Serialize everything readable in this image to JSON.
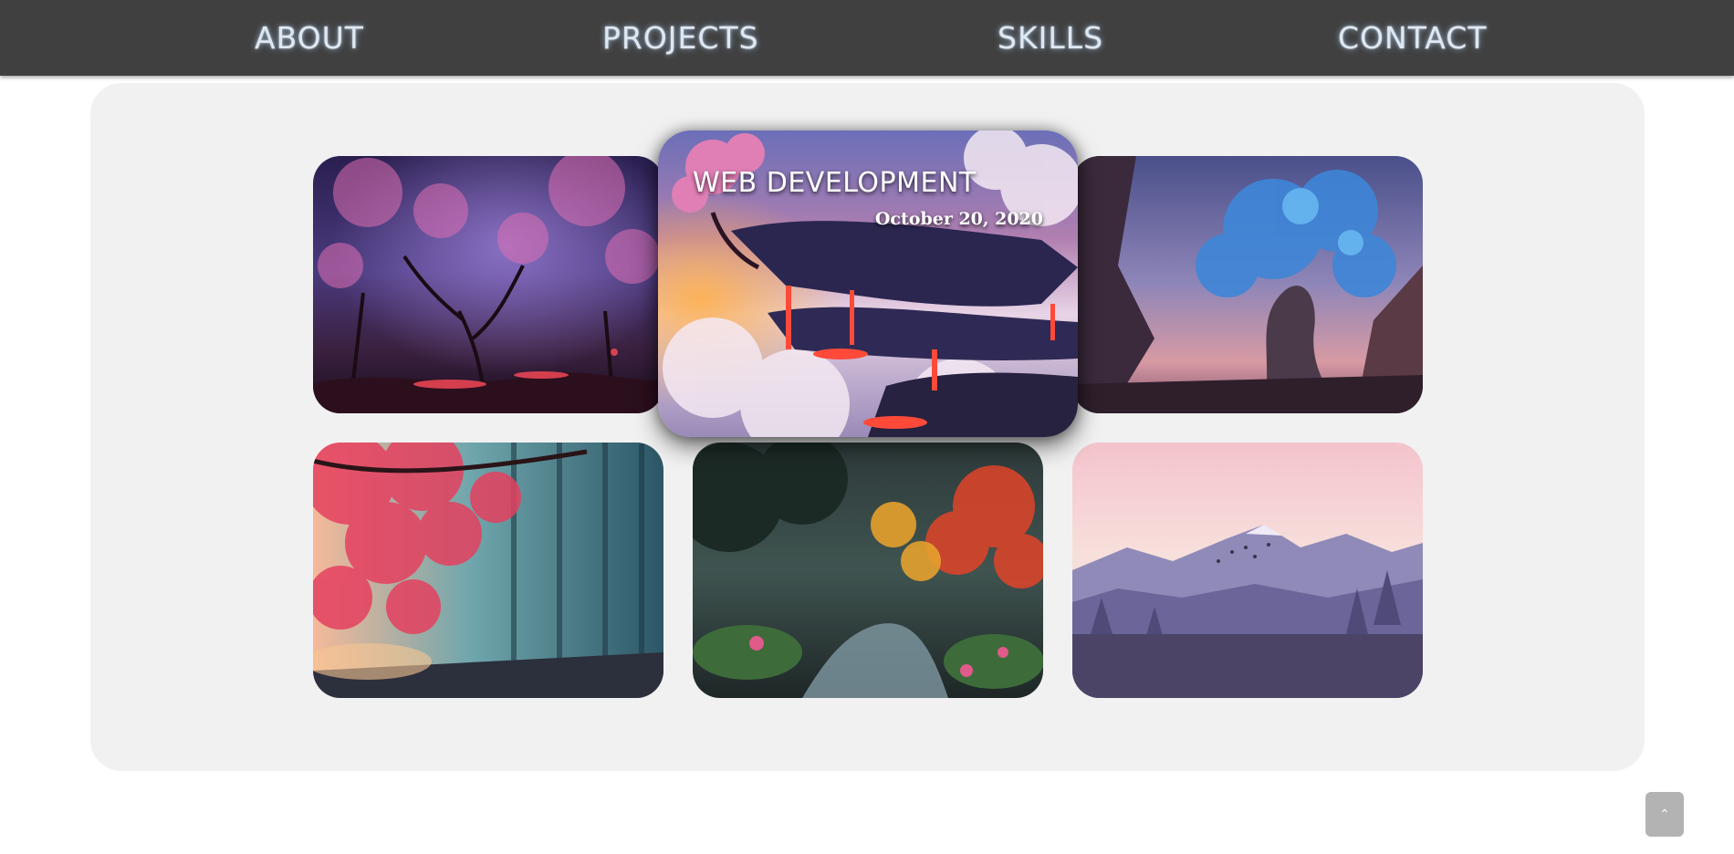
{
  "nav": {
    "items": [
      {
        "label": "ABOUT"
      },
      {
        "label": "PROJECTS"
      },
      {
        "label": "SKILLS"
      },
      {
        "label": "CONTACT"
      }
    ]
  },
  "gallery": {
    "featured": {
      "title": "WEB DEVELOPMENT",
      "date": "October 20, 2020"
    },
    "cards": [
      {
        "scene": "cherry-blossom-night-forest"
      },
      {
        "scene": "floating-island-lava-clouds"
      },
      {
        "scene": "giant-blue-tree-canyon"
      },
      {
        "scene": "pink-tree-misty-forest"
      },
      {
        "scene": "autumn-forest-river"
      },
      {
        "scene": "purple-mountains-birds"
      }
    ]
  },
  "scroll_top": {
    "icon": "chevron-up-icon",
    "glyph": "⌃"
  },
  "colors": {
    "nav_bg": "#404040",
    "nav_text": "#dfe7f1",
    "panel_bg": "#f1f1f2",
    "scroll_btn": "#b3b3b3"
  }
}
